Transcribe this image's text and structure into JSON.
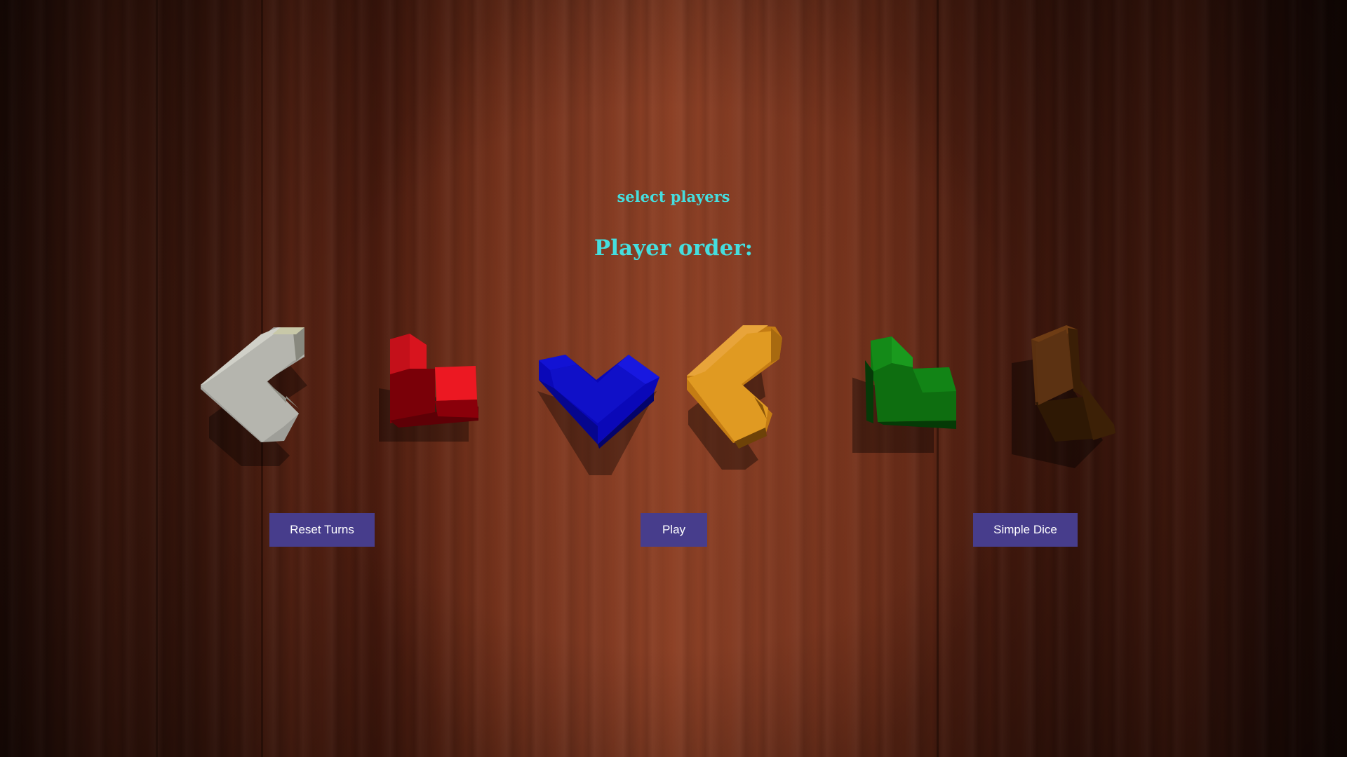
{
  "header": {
    "select_players": "select players",
    "player_order": "Player order:"
  },
  "pieces": [
    {
      "name": "white-piece",
      "color": "#b8b8b0"
    },
    {
      "name": "red-piece",
      "color": "#e0101a"
    },
    {
      "name": "blue-piece",
      "color": "#0a0ac8"
    },
    {
      "name": "orange-piece",
      "color": "#e09a22"
    },
    {
      "name": "green-piece",
      "color": "#0e7a12"
    },
    {
      "name": "brown-piece",
      "color": "#5a3010"
    }
  ],
  "buttons": {
    "reset_turns": "Reset Turns",
    "play": "Play",
    "simple_dice": "Simple Dice"
  },
  "theme": {
    "title_color": "#45dede",
    "button_color": "#473d8c"
  }
}
